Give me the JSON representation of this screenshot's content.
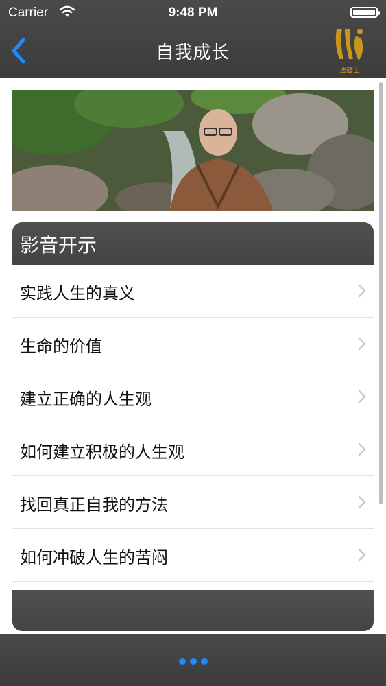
{
  "status": {
    "carrier": "Carrier",
    "time": "9:48 PM"
  },
  "nav": {
    "title": "自我成长",
    "back_icon": "chevron-left-icon",
    "logo_text": "法鼓山"
  },
  "section": {
    "title": "影音开示"
  },
  "items": [
    {
      "label": "实践人生的真义"
    },
    {
      "label": "生命的价值"
    },
    {
      "label": "建立正确的人生观"
    },
    {
      "label": "如何建立积极的人生观"
    },
    {
      "label": "找回真正自我的方法"
    },
    {
      "label": "如何冲破人生的苦闷"
    }
  ],
  "colors": {
    "bar": "#444444",
    "accent": "#1a8cff",
    "logo": "#c8961e"
  }
}
